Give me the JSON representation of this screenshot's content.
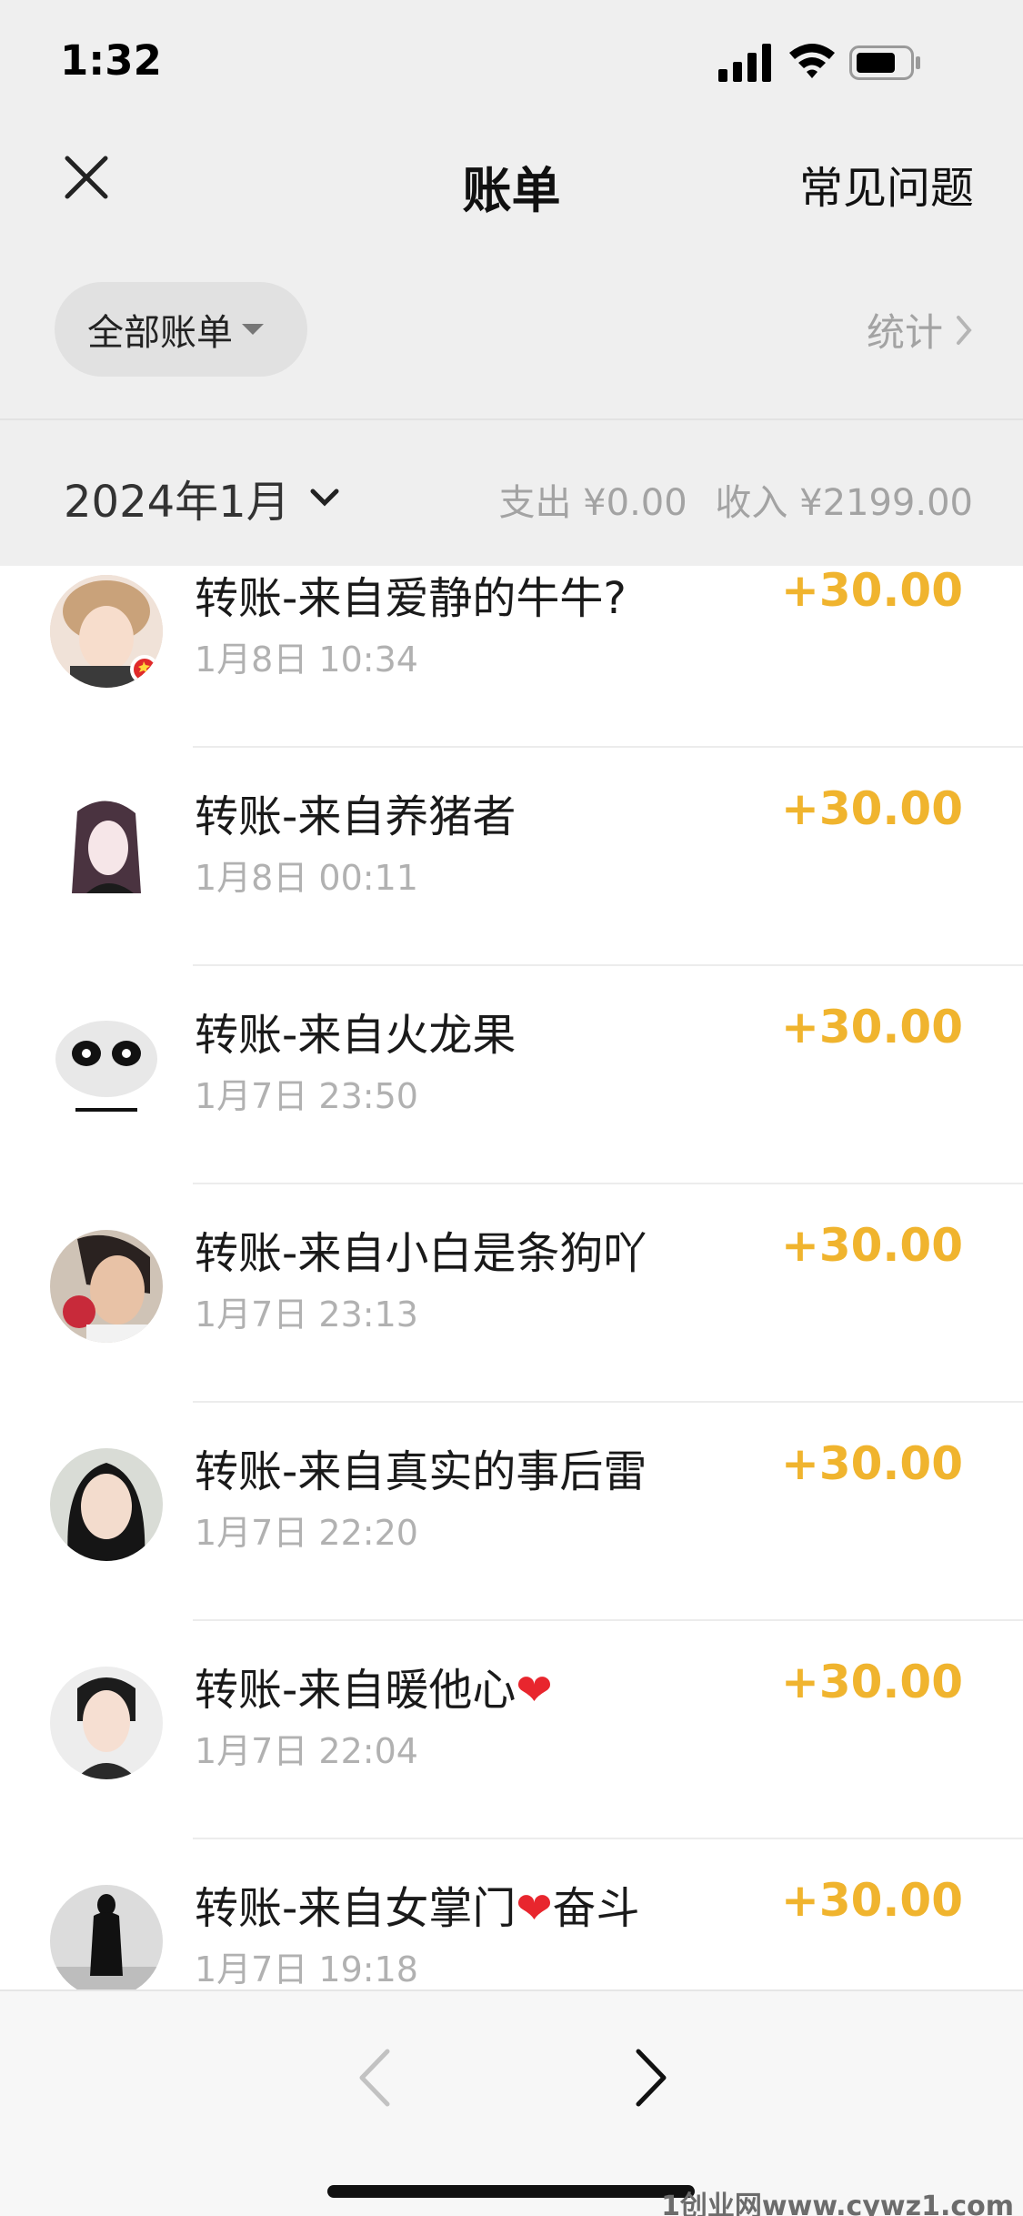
{
  "status_bar": {
    "time": "1:32",
    "icons": [
      "signal-icon",
      "wifi-icon",
      "battery-icon"
    ]
  },
  "nav": {
    "title": "账单",
    "right_link": "常见问题",
    "close_icon": "close-icon"
  },
  "filter": {
    "label": "全部账单",
    "stats_label": "统计"
  },
  "month": {
    "label": "2024年1月",
    "summary_expense": "支出 ¥0.00",
    "summary_income": "收入 ¥2199.00"
  },
  "transactions": [
    {
      "title": "转账-来自爱静的牛牛?",
      "time": "1月8日 10:34",
      "amount": "+30.00"
    },
    {
      "title": "转账-来自养猪者",
      "time": "1月8日 00:11",
      "amount": "+30.00"
    },
    {
      "title": "转账-来自火龙果",
      "time": "1月7日 23:50",
      "amount": "+30.00"
    },
    {
      "title": "转账-来自小白是条狗吖",
      "time": "1月7日 23:13",
      "amount": "+30.00"
    },
    {
      "title": "转账-来自真实的事后雷",
      "time": "1月7日 22:20",
      "amount": "+30.00"
    },
    {
      "title_prefix": "转账-来自暖他心",
      "title_suffix": "",
      "time": "1月7日 22:04",
      "amount": "+30.00"
    },
    {
      "title_prefix": "转账-来自女掌门",
      "title_suffix": "奋斗",
      "time": "1月7日 19:18",
      "amount": "+30.00"
    }
  ],
  "colors": {
    "amount": "#f0b42e",
    "heart": "#e8262e",
    "header_bg": "#efefef"
  },
  "watermark": "1创业网www.cywz1.com"
}
